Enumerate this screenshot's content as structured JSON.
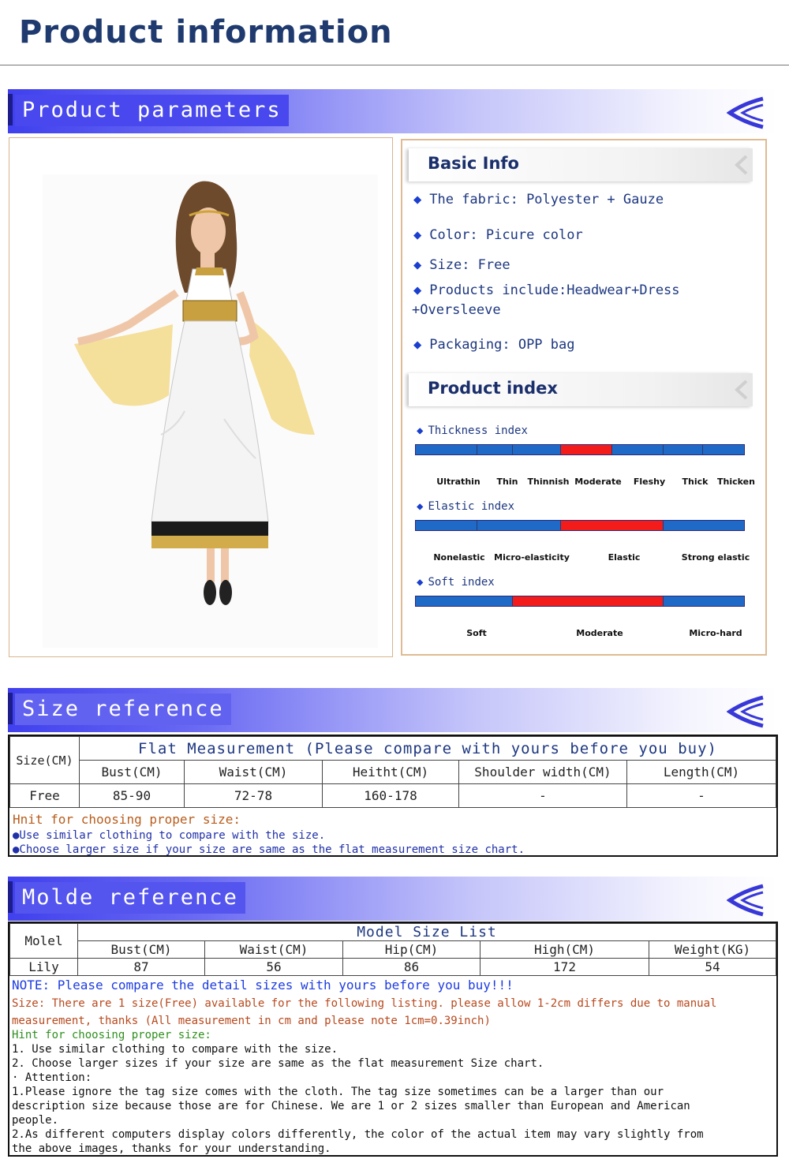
{
  "header": {
    "title": "Product information"
  },
  "sections": {
    "product_parameters": "Product parameters",
    "size_reference": "Size reference",
    "molde_reference": "Molde reference"
  },
  "basic_info": {
    "title": "Basic Info",
    "fabric": "The fabric:  Polyester + Gauze",
    "color": "Color: Picure color",
    "size": "Size: Free",
    "products_line1": "Products include:Headwear+Dress",
    "products_line2": "+Oversleeve",
    "packaging": "Packaging: OPP bag"
  },
  "product_index": {
    "title": "Product index",
    "thickness": {
      "title": "Thickness index",
      "labels": [
        "Ultrathin",
        "Thin",
        "Thinnish",
        "Moderate",
        "Fleshy",
        "Thick",
        "Thicken"
      ],
      "selected": "Moderate"
    },
    "elastic": {
      "title": "Elastic index",
      "labels": [
        "Nonelastic",
        "Micro-elasticity",
        "Elastic",
        "Strong elastic"
      ],
      "selected": "Elastic"
    },
    "soft": {
      "title": "Soft index",
      "labels": [
        "Soft",
        "Moderate",
        "Micro-hard"
      ],
      "selected": "Moderate"
    }
  },
  "size_table": {
    "corner": "Size(CM)",
    "caption": "Flat Measurement (Please compare with yours before you buy)",
    "headers": [
      "Bust(CM)",
      "Waist(CM)",
      "Heitht(CM)",
      "Shoulder width(CM)",
      "Length(CM)"
    ],
    "row_label": "Free",
    "values": [
      "85-90",
      "72-78",
      "160-178",
      "-",
      "-"
    ],
    "hint_title": "Hnit for choosing proper size:",
    "hint1": "●Use similar clothing to compare with the size.",
    "hint2": "●Choose larger size if your size are same as the flat measurement size chart."
  },
  "model_table": {
    "corner": "Molel",
    "caption": "Model Size List",
    "headers": [
      "Bust(CM)",
      "Waist(CM)",
      "Hip(CM)",
      "High(CM)",
      "Weight(KG)"
    ],
    "row_label": "Lily",
    "values": [
      "87",
      "56",
      "86",
      "172",
      "54"
    ]
  },
  "notes": {
    "note": "NOTE: Please compare the detail sizes with yours before you buy!!!",
    "size_line1": " Size: There are 1 size(Free) available for the following listing. please allow 1-2cm differs due to manual",
    "size_line2": "measurement, thanks (All measurement in cm and please note 1cm=0.39inch)",
    "hint_title": "Hint for choosing proper size:",
    "hint1": "1. Use similar clothing to compare with the size.",
    "hint2": "2. Choose larger sizes if your size are same as the flat measurement Size   chart.",
    "attention": "·  Attention:",
    "att1_line1": "1.Please ignore the tag size comes with the cloth. The tag size sometimes can be a larger than our",
    "att1_line2": "description size because those are for Chinese. We are 1 or 2 sizes smaller than European and American",
    "att1_line3": "people.",
    "att2_line1": "2.As different computers display colors differently, the color of the actual item may vary slightly from",
    "att2_line2": "the above images, thanks for your understanding."
  }
}
